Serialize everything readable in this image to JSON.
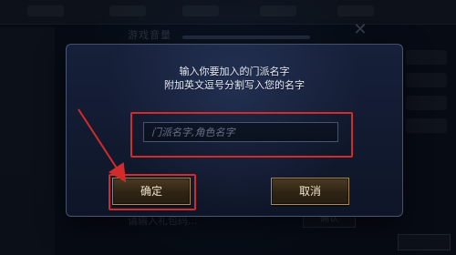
{
  "dialog": {
    "message_line1": "输入你要加入的门派名字",
    "message_line2": "附加英文逗号分割写入您的名字",
    "input": {
      "placeholder": "门派名字,角色名字",
      "value": ""
    },
    "buttons": {
      "ok_label": "确定",
      "cancel_label": "取消"
    }
  },
  "background_ui": {
    "settings_title": "游戏音量",
    "gift_code_placeholder": "请输入礼包码...",
    "gift_confirm_label": "确认"
  },
  "theme": {
    "highlight_red": "#d22b2b",
    "button_gold_border": "#ffd28c"
  },
  "icons": {
    "close": "close-icon",
    "annotation_arrow": "red-arrow-icon"
  }
}
